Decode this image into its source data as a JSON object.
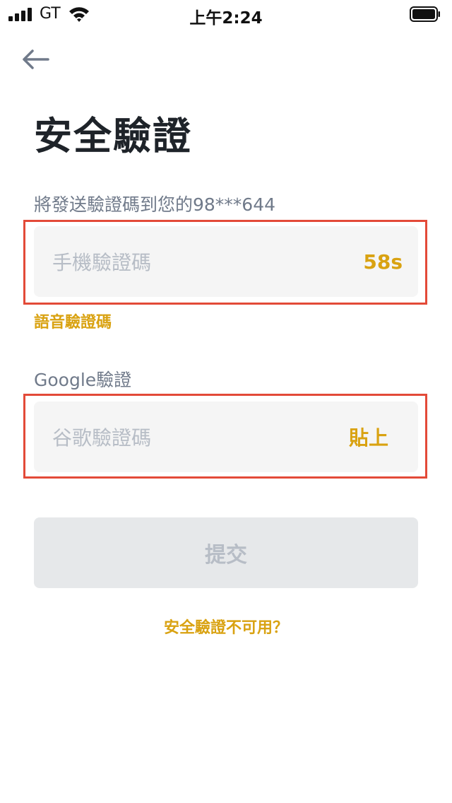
{
  "status_bar": {
    "carrier": "GT",
    "time": "上午2:24",
    "signal_icon": "cellular-signal-icon",
    "wifi_icon": "wifi-icon",
    "battery_icon": "battery-icon"
  },
  "header": {
    "back_icon": "arrow-left-icon",
    "title": "安全驗證"
  },
  "sms_section": {
    "label": "將發送驗證碼到您的98***644",
    "placeholder": "手機驗證碼",
    "countdown": "58s",
    "voice_link": "語音驗證碼"
  },
  "google_section": {
    "label": "Google驗證",
    "placeholder": "谷歌驗證碼",
    "paste_label": "貼上"
  },
  "submit_label": "提交",
  "unavailable_link": "安全驗證不可用？",
  "colors": {
    "accent": "#d9a211",
    "highlight": "#e34a38",
    "title": "#1e2329",
    "label": "#707a8a",
    "field_bg": "#f5f5f5",
    "button_disabled_bg": "#e6e8ea",
    "button_disabled_text": "#b7bdc6"
  }
}
